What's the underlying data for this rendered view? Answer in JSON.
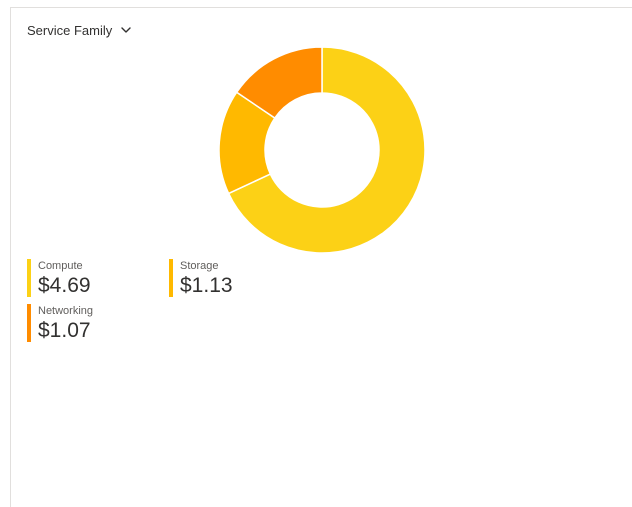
{
  "header": {
    "dropdown_label": "Service Family",
    "dropdown_icon": "chevron-down-icon"
  },
  "chart_data": {
    "type": "pie",
    "style": "donut",
    "categories": [
      "Compute",
      "Storage",
      "Networking"
    ],
    "values": [
      4.69,
      1.13,
      1.07
    ],
    "colors": [
      "#fcd116",
      "#ffb900",
      "#ff8c00"
    ],
    "title": "",
    "xlabel": "",
    "ylabel": ""
  },
  "legend": {
    "items": [
      {
        "label": "Compute",
        "value": "$4.69",
        "color": "#fcd116"
      },
      {
        "label": "Storage",
        "value": "$1.13",
        "color": "#ffb900"
      },
      {
        "label": "Networking",
        "value": "$1.07",
        "color": "#ff8c00"
      }
    ]
  }
}
